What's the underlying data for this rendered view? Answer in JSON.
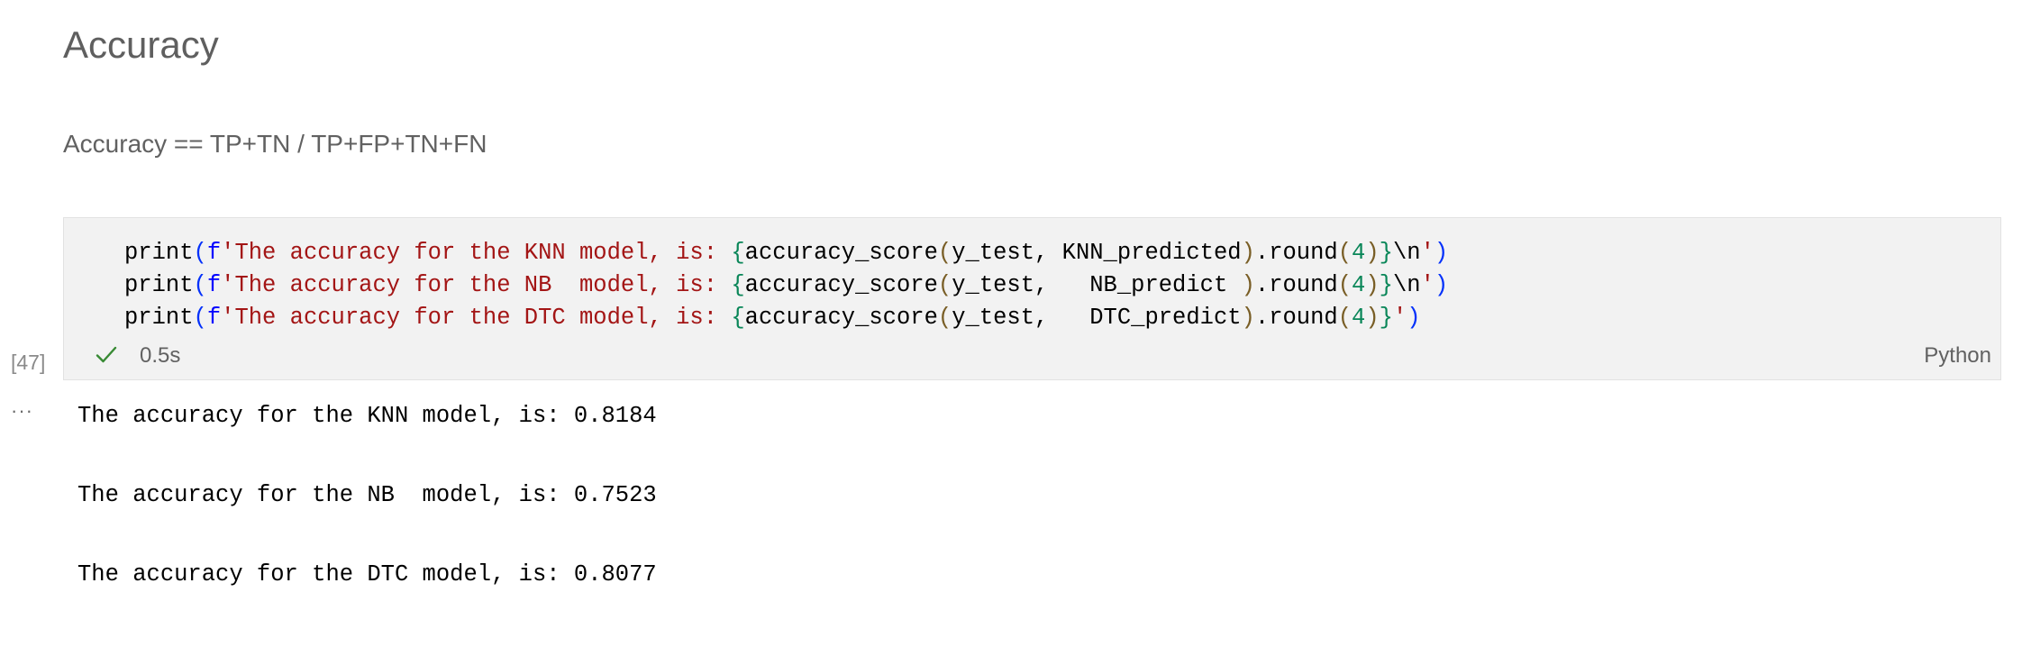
{
  "markdown": {
    "heading": "Accuracy",
    "formula": "Accuracy == TP+TN / TP+FP+TN+FN"
  },
  "cell": {
    "execution_count": "[47]",
    "duration": "0.5s",
    "language": "Python",
    "status_icon": "check-icon",
    "code_lines": [
      {
        "fn": "print",
        "open": "(",
        "prefix": "f",
        "str_open": "'The accuracy for the KNN model, is: ",
        "brace_open": "{",
        "call": "accuracy_score",
        "p_open": "(",
        "args": "y_test, KNN_predicted",
        "p_close": ")",
        "method": ".round",
        "r_open": "(",
        "num": "4",
        "r_close": ")",
        "brace_close": "}",
        "escape": "\\n",
        "str_close": "'",
        "close": ")"
      },
      {
        "fn": "print",
        "open": "(",
        "prefix": "f",
        "str_open": "'The accuracy for the NB  model, is: ",
        "brace_open": "{",
        "call": "accuracy_score",
        "p_open": "(",
        "args": "y_test,   NB_predict ",
        "p_close": ")",
        "method": ".round",
        "r_open": "(",
        "num": "4",
        "r_close": ")",
        "brace_close": "}",
        "escape": "\\n",
        "str_close": "'",
        "close": ")"
      },
      {
        "fn": "print",
        "open": "(",
        "prefix": "f",
        "str_open": "'The accuracy for the DTC model, is: ",
        "brace_open": "{",
        "call": "accuracy_score",
        "p_open": "(",
        "args": "y_test,   DTC_predict",
        "p_close": ")",
        "method": ".round",
        "r_open": "(",
        "num": "4",
        "r_close": ")",
        "brace_close": "}",
        "escape": "",
        "str_close": "'",
        "close": ")"
      }
    ],
    "output_menu": "···",
    "outputs": [
      "The accuracy for the KNN model, is: 0.8184",
      "The accuracy for the NB  model, is: 0.7523",
      "The accuracy for the DTC model, is: 0.8077"
    ]
  },
  "colors": {
    "string": "#a31515",
    "keyword_prefix": "#0000ff",
    "bracket": "#0431fa",
    "number": "#098658",
    "check": "#388a34",
    "cell_background": "#f2f2f2"
  }
}
